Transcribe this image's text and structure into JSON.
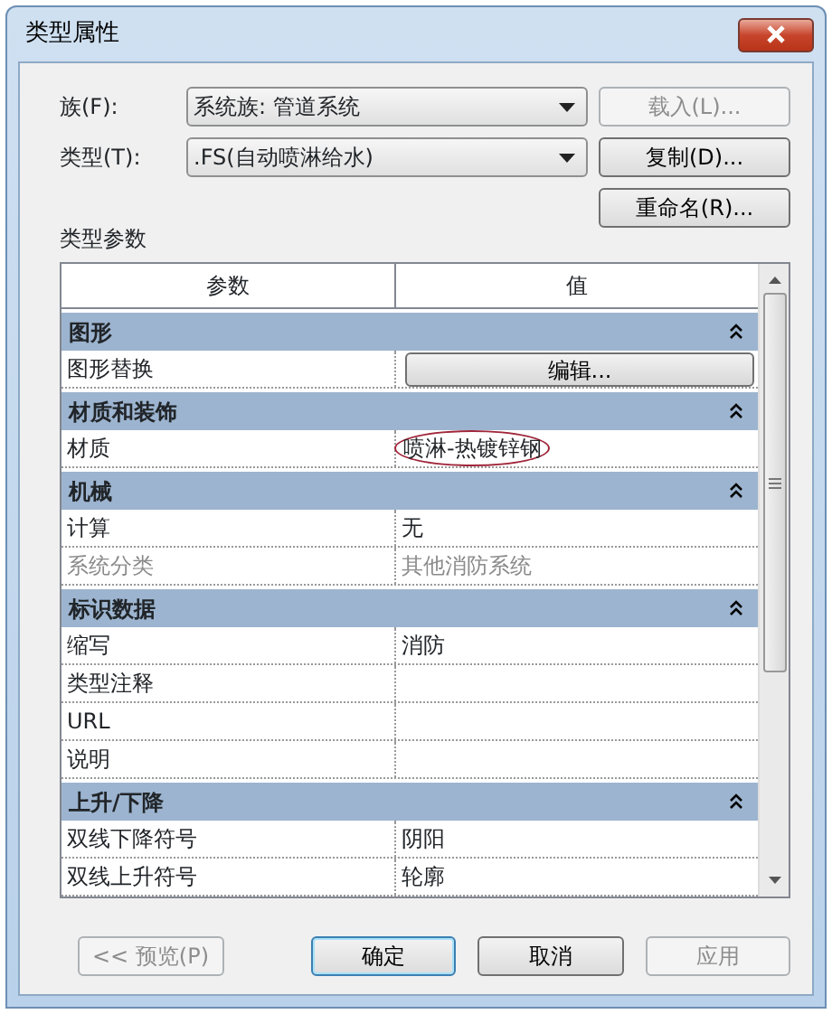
{
  "window": {
    "title": "类型属性"
  },
  "fields": [
    {
      "label": "族(F):",
      "value": "系统族: 管道系统"
    },
    {
      "label": "类型(T):",
      "value": ".FS(自动喷淋给水)"
    }
  ],
  "side_buttons": [
    {
      "label": "载入(L)...",
      "disabled": true
    },
    {
      "label": "复制(D)...",
      "disabled": false
    },
    {
      "label": "重命名(R)...",
      "disabled": false
    }
  ],
  "section_label": "类型参数",
  "table": {
    "columns": [
      "参数",
      "值"
    ],
    "rows": [
      {
        "kind": "group",
        "label": "图形",
        "expanded": true
      },
      {
        "kind": "button",
        "name": "图形替换",
        "button": "编辑...",
        "disabled": false
      },
      {
        "kind": "group",
        "label": "材质和装饰",
        "expanded": true
      },
      {
        "kind": "param",
        "name": "材质",
        "value": "喷淋-热镀锌钢",
        "disabled": false,
        "circled": true
      },
      {
        "kind": "group",
        "label": "机械",
        "expanded": true
      },
      {
        "kind": "param",
        "name": "计算",
        "value": "无",
        "disabled": false
      },
      {
        "kind": "param",
        "name": "系统分类",
        "value": "其他消防系统",
        "disabled": true
      },
      {
        "kind": "group",
        "label": "标识数据",
        "expanded": true
      },
      {
        "kind": "param",
        "name": "缩写",
        "value": "消防",
        "disabled": false
      },
      {
        "kind": "param",
        "name": "类型注释",
        "disabled": false
      },
      {
        "kind": "param",
        "name": "URL",
        "disabled": false
      },
      {
        "kind": "param",
        "name": "说明",
        "disabled": false
      },
      {
        "kind": "group",
        "label": "上升/下降",
        "expanded": true
      },
      {
        "kind": "param",
        "name": "双线下降符号",
        "value": "阴阳",
        "disabled": false
      },
      {
        "kind": "param",
        "name": "双线上升符号",
        "value": "轮廓",
        "disabled": false
      }
    ]
  },
  "bottom_buttons": [
    {
      "label": "<< 预览(P)",
      "disabled": true,
      "default": false
    },
    {
      "label": "确定",
      "disabled": false,
      "default": true
    },
    {
      "label": "取消",
      "disabled": false,
      "default": false
    },
    {
      "label": "应用",
      "disabled": true,
      "default": false
    }
  ]
}
